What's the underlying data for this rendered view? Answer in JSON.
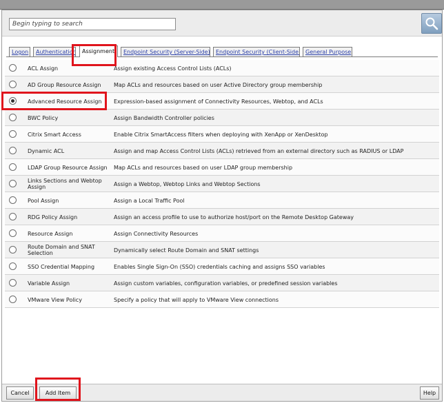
{
  "search": {
    "placeholder": "Begin typing to search"
  },
  "icons": {
    "search_button": "magnifier-icon"
  },
  "tabs": [
    {
      "label": "Logon"
    },
    {
      "label": "Authentication"
    },
    {
      "label": "Assignment",
      "active": true
    },
    {
      "label": "Endpoint Security (Server-Side)"
    },
    {
      "label": "Endpoint Security (Client-Side)"
    },
    {
      "label": "General Purpose"
    }
  ],
  "items": [
    {
      "name": "ACL Assign",
      "description": "Assign existing Access Control Lists (ACLs)",
      "selected": false
    },
    {
      "name": "AD Group Resource Assign",
      "description": "Map ACLs and resources based on user Active Directory group membership",
      "selected": false
    },
    {
      "name": "Advanced Resource Assign",
      "description": "Expression-based assignment of Connectivity Resources, Webtop, and ACLs",
      "selected": true
    },
    {
      "name": "BWC Policy",
      "description": "Assign Bandwidth Controller policies",
      "selected": false
    },
    {
      "name": "Citrix Smart Access",
      "description": "Enable Citrix SmartAccess filters when deploying with XenApp or XenDesktop",
      "selected": false
    },
    {
      "name": "Dynamic ACL",
      "description": "Assign and map Access Control Lists (ACLs) retrieved from an external directory such as RADIUS or LDAP",
      "selected": false
    },
    {
      "name": "LDAP Group Resource Assign",
      "description": "Map ACLs and resources based on user LDAP group membership",
      "selected": false
    },
    {
      "name": "Links Sections and Webtop Assign",
      "description": "Assign a Webtop, Webtop Links and Webtop Sections",
      "selected": false
    },
    {
      "name": "Pool Assign",
      "description": "Assign a Local Traffic Pool",
      "selected": false
    },
    {
      "name": "RDG Policy Assign",
      "description": "Assign an access profile to use to authorize host/port on the Remote Desktop Gateway",
      "selected": false
    },
    {
      "name": "Resource Assign",
      "description": "Assign Connectivity Resources",
      "selected": false
    },
    {
      "name": "Route Domain and SNAT Selection",
      "description": "Dynamically select Route Domain and SNAT settings",
      "selected": false
    },
    {
      "name": "SSO Credential Mapping",
      "description": "Enables Single Sign-On (SSO) credentials caching and assigns SSO variables",
      "selected": false
    },
    {
      "name": "Variable Assign",
      "description": "Assign custom variables, configuration variables, or predefined session variables",
      "selected": false
    },
    {
      "name": "VMware View Policy",
      "description": "Specify a policy that will apply to VMware View connections",
      "selected": false
    }
  ],
  "footer": {
    "cancel_label": "Cancel",
    "add_label": "Add Item",
    "help_label": "Help"
  },
  "colors": {
    "highlight": "#e0141c",
    "tab_link": "#2a3fa8"
  }
}
